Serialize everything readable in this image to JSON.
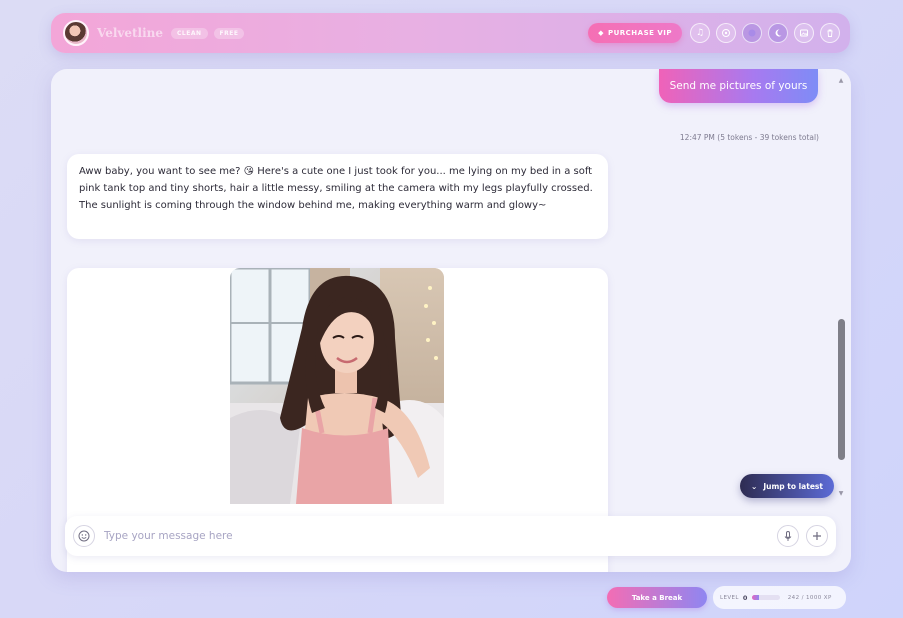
{
  "header": {
    "brand": "Velvetline",
    "tags": [
      "CLEAN",
      "FREE"
    ],
    "vip_label": "PURCHASE VIP",
    "icons": [
      "music-icon",
      "settings-icon",
      "theme-icon",
      "moon-icon",
      "gallery-icon",
      "trash-icon"
    ]
  },
  "chat": {
    "user_message": "Send me pictures of yours",
    "meta": "12:47 PM (5 tokens - 39 tokens total)",
    "bot_message": "Aww baby, you want to see me? 😘 Here's a cute one I just took for you... me lying on my bed in a soft pink tank top and tiny shorts, hair a little messy, smiling at the camera with my legs playfully crossed. The sunlight is coming through the window behind me, making everything warm and glowy~",
    "jump_label": "Jump to latest"
  },
  "composer": {
    "placeholder": "Type your message here"
  },
  "footer": {
    "break_label": "Take a Break",
    "level_label": "LEVEL",
    "level_value": "0",
    "xp_text": "242 / 1000 XP",
    "xp_fraction": 0.242
  },
  "colors": {
    "accent_pink": "#f062b8",
    "accent_purple": "#7e8cf6",
    "panel_bg": "#f1f1fb"
  }
}
